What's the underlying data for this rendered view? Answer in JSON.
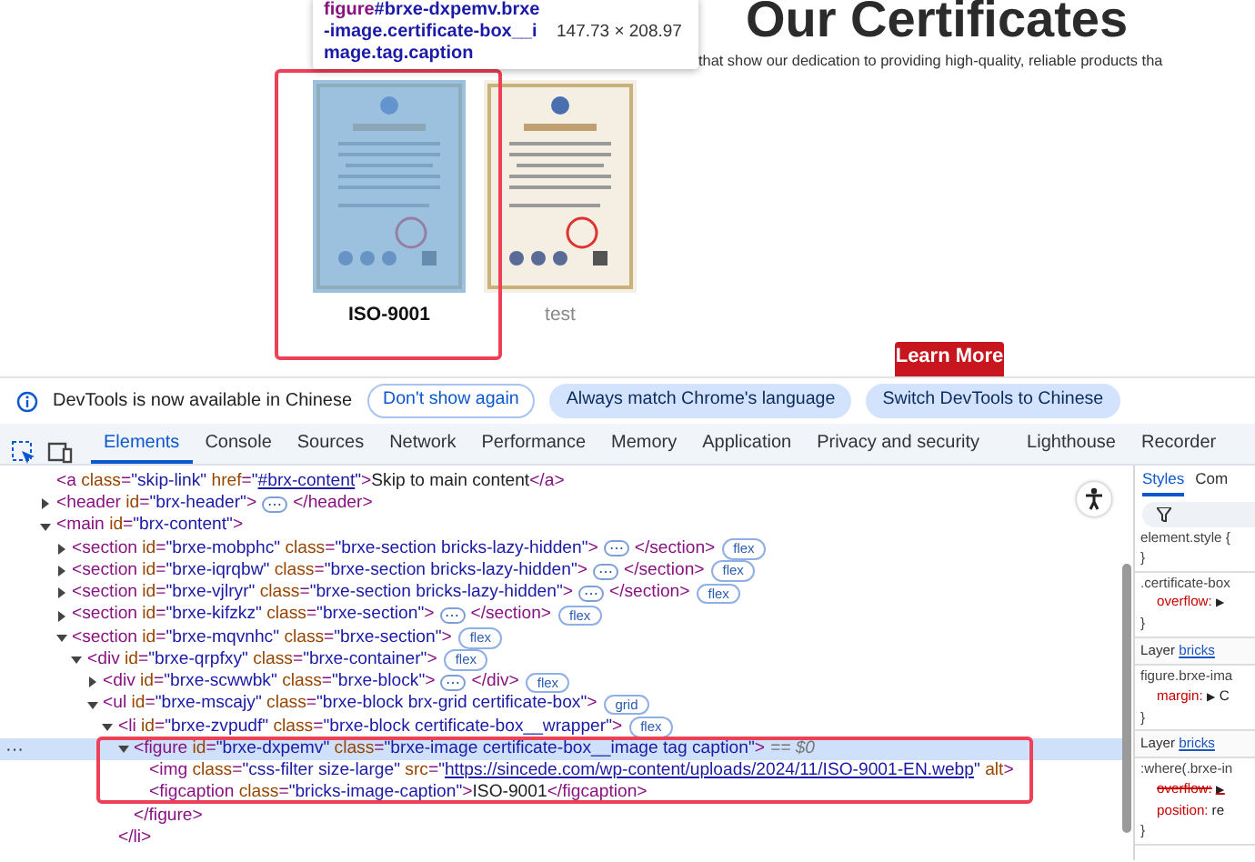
{
  "page": {
    "heading": "Our Certificates",
    "subtitle": "that show our dedication to providing high-quality, reliable products tha",
    "certificates": [
      {
        "caption": "ISO-9001",
        "highlighted": true
      },
      {
        "caption": "test",
        "highlighted": false
      }
    ],
    "button": "Learn More",
    "tooltip": {
      "tag": "figure",
      "selector": "#brxe-dxpemv.brxe-image.certificate-box__image.tag.caption",
      "size": "147.73 × 208.97"
    }
  },
  "infobar": {
    "message": "DevTools is now available in Chinese",
    "buttons": [
      {
        "label": "Don't show again",
        "kind": "outline"
      },
      {
        "label": "Always match Chrome's language",
        "kind": "filled"
      },
      {
        "label": "Switch DevTools to Chinese",
        "kind": "filled"
      }
    ]
  },
  "tabs": [
    {
      "label": "Elements",
      "selected": true
    },
    {
      "label": "Console",
      "selected": false
    },
    {
      "label": "Sources",
      "selected": false
    },
    {
      "label": "Network",
      "selected": false
    },
    {
      "label": "Performance",
      "selected": false
    },
    {
      "label": "Memory",
      "selected": false
    },
    {
      "label": "Application",
      "selected": false
    },
    {
      "label": "Privacy and security",
      "selected": false
    },
    {
      "label": "Lighthouse",
      "selected": false
    },
    {
      "label": "Recorder",
      "selected": false
    }
  ],
  "dom": [
    {
      "open": "<a class=\"skip-link\" href=\"",
      "link": "#brx-content",
      "open_rest": "\">",
      "content": "Skip to main content",
      "close": "</a>",
      "selected": false
    },
    {
      "open": "<header id=\"brx-header\">",
      "expanded": false,
      "ellipsis": "⋯",
      "close": "</header>",
      "selected": false
    },
    {
      "open": "<main id=\"brx-content\">",
      "expanded": true,
      "selected": false,
      "children": [
        {
          "open": "<section id=\"brxe-mobphc\" class=\"brxe-section bricks-lazy-hidden\">",
          "expanded": false,
          "ellipsis": "⋯",
          "close": "</section>",
          "badge": "flex",
          "selected": false
        },
        {
          "open": "<section id=\"brxe-iqrqbw\" class=\"brxe-section bricks-lazy-hidden\">",
          "expanded": false,
          "ellipsis": "⋯",
          "close": "</section>",
          "badge": "flex",
          "selected": false
        },
        {
          "open": "<section id=\"brxe-vjlryr\" class=\"brxe-section bricks-lazy-hidden\">",
          "expanded": false,
          "ellipsis": "⋯",
          "close": "</section>",
          "badge": "flex",
          "selected": false
        },
        {
          "open": "<section id=\"brxe-kifzkz\" class=\"brxe-section\">",
          "expanded": false,
          "ellipsis": "⋯",
          "close": "</section>",
          "badge": "flex",
          "selected": false
        },
        {
          "open": "<section id=\"brxe-mqvnhc\" class=\"brxe-section\">",
          "expanded": true,
          "badge": "flex",
          "selected": false,
          "children": [
            {
              "open": "<div id=\"brxe-qrpfxy\" class=\"brxe-container\">",
              "expanded": true,
              "badge": "flex",
              "selected": false,
              "children": [
                {
                  "open": "<div id=\"brxe-scwwbk\" class=\"brxe-block\">",
                  "expanded": false,
                  "ellipsis": "⋯",
                  "close": "</div>",
                  "badge": "flex",
                  "selected": false
                },
                {
                  "open": "<ul id=\"brxe-mscajy\" class=\"brxe-block brx-grid certificate-box\">",
                  "expanded": true,
                  "badge": "grid",
                  "selected": false,
                  "children": [
                    {
                      "open": "<li id=\"brxe-zvpudf\" class=\"brxe-block certificate-box__wrapper\">",
                      "expanded": true,
                      "badge": "flex",
                      "selected": false,
                      "close": "</li>",
                      "children": [
                        {
                          "open": "<figure id=\"brxe-dxpemv\" class=\"brxe-image certificate-box__image tag caption\">",
                          "expanded": true,
                          "selected": true,
                          "suffix": "== $0",
                          "gutter": "···",
                          "close": "</figure>",
                          "children": [
                            {
                              "open": "<img class=\"css-filter size-large\" src=\"",
                              "link": "https://sincede.com/wp-content/uploads/2024/11/ISO-9001-EN.webp",
                              "open_rest": "\" alt>",
                              "selected": false
                            },
                            {
                              "open": "<figcaption class=\"bricks-image-caption\">",
                              "content": "ISO-9001",
                              "close": "</figcaption>",
                              "selected": false
                            }
                          ]
                        }
                      ]
                    }
                  ]
                }
              ]
            }
          ]
        }
      ]
    }
  ],
  "styles": {
    "tabs": [
      {
        "label": "Styles",
        "selected": true
      },
      {
        "label": "Com",
        "selected": false
      }
    ],
    "blocks": [
      {
        "kind": "rule",
        "selector": "element.style {",
        "end": "}"
      },
      {
        "kind": "rule",
        "selector": ".certificate-box",
        "declarations": [
          {
            "property": "overflow:",
            "toggle": "▶",
            "overridden": false
          }
        ],
        "end": "}"
      },
      {
        "kind": "layer",
        "label": "Layer",
        "link": "bricks"
      },
      {
        "kind": "rule",
        "selector": "figure.brxe-ima",
        "declarations": [
          {
            "property": "margin:",
            "toggle": "▶",
            "value": "C",
            "overridden": false
          }
        ],
        "end": "}"
      },
      {
        "kind": "layer",
        "label": "Layer",
        "link": "bricks"
      },
      {
        "kind": "rule",
        "selector": ":where(.brxe-in",
        "declarations": [
          {
            "property": "overflow:",
            "toggle": "▶",
            "overridden": true
          },
          {
            "property": "position:",
            "value": "re",
            "overridden": false
          }
        ],
        "end": "}"
      }
    ]
  }
}
